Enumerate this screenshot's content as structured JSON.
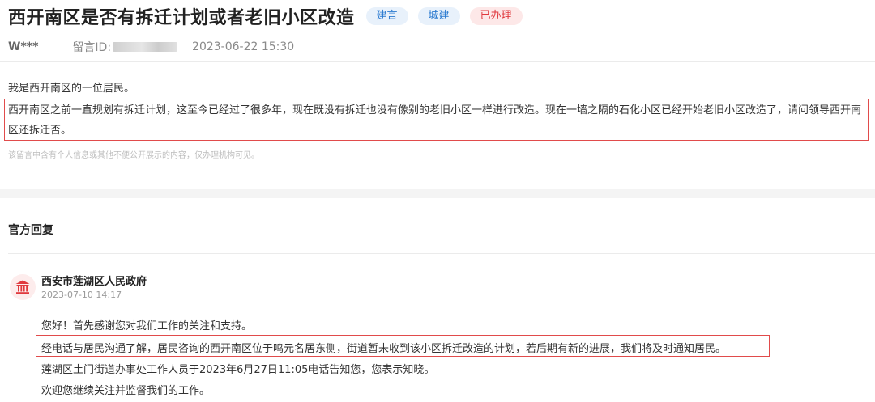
{
  "post": {
    "title": "西开南区是否有拆迁计划或者老旧小区改造",
    "tags": [
      {
        "label": "建言",
        "color": "#2b7ad0"
      },
      {
        "label": "城建",
        "color": "#2b7ad0"
      },
      {
        "label": "已办理",
        "color": "#e0393e"
      }
    ],
    "author": "W***",
    "message_id_label": "留言ID:",
    "datetime": "2023-06-22 15:30",
    "intro": "我是西开南区的一位居民。",
    "body": "西开南区之前一直规划有拆迁计划，这至今已经过了很多年，现在既没有拆迁也没有像别的老旧小区一样进行改造。现在一墙之隔的石化小区已经开始老旧小区改造了，请问领导西开南区还拆迁否。",
    "privacy_notice": "该留言中含有个人信息或其他不便公开展示的内容，仅办理机构可见。"
  },
  "reply": {
    "section_title": "官方回复",
    "icon": "government-building-icon",
    "org_name": "西安市莲湖区人民政府",
    "datetime": "2023-07-10 14:17",
    "lines": [
      "您好！首先感谢您对我们工作的关注和支持。",
      "经电话与居民沟通了解，居民咨询的西开南区位于鸣元名居东侧，街道暂未收到该小区拆迁改造的计划，若后期有新的进展，我们将及时通知居民。",
      "莲湖区土门街道办事处工作人员于2023年6月27日11:05电话告知您，您表示知晓。",
      "欢迎您继续关注并监督我们的工作。"
    ]
  },
  "colors": {
    "highlight_border": "#e14b4b",
    "tag_blue_bg": "#e8f1fb",
    "tag_red_bg": "#fde8e8"
  }
}
